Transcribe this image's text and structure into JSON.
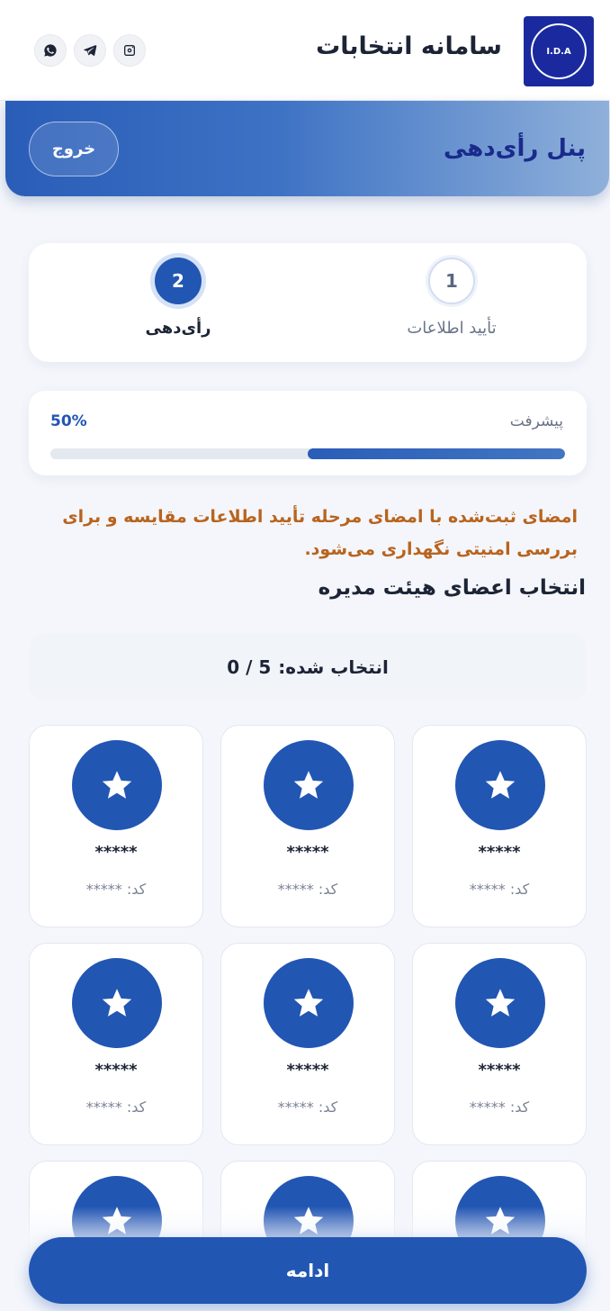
{
  "header": {
    "title": "سامانه انتخابات",
    "logo_text": "I.D.A",
    "social": [
      "instagram-icon",
      "telegram-icon",
      "whatsapp-icon"
    ]
  },
  "panel": {
    "title": "پنل رأی‌دهی",
    "logout_label": "خروج"
  },
  "steps": [
    {
      "number": "1",
      "label": "تأیید اطلاعات",
      "state": "inactive"
    },
    {
      "number": "2",
      "label": "رأی‌دهی",
      "state": "active"
    }
  ],
  "progress": {
    "label": "پیشرفت",
    "value_text": "50%",
    "value": 0.5
  },
  "notice": "امضای ثبت‌شده با امضای مرحله تأیید اطلاعات مقایسه و برای بررسی امنیتی نگهداری می‌شود.",
  "section_title": "انتخاب اعضای هیئت مدیره",
  "selection": {
    "label": "انتخاب شده:",
    "count": "0 / 5"
  },
  "candidates": [
    {
      "name": "*****",
      "code_label": "کد:",
      "code": "*****"
    },
    {
      "name": "*****",
      "code_label": "کد:",
      "code": "*****"
    },
    {
      "name": "*****",
      "code_label": "کد:",
      "code": "*****"
    },
    {
      "name": "*****",
      "code_label": "کد:",
      "code": "*****"
    },
    {
      "name": "*****",
      "code_label": "کد:",
      "code": "*****"
    },
    {
      "name": "*****",
      "code_label": "کد:",
      "code": "*****"
    },
    {
      "name": "",
      "code_label": "",
      "code": ""
    },
    {
      "name": "",
      "code_label": "",
      "code": ""
    },
    {
      "name": "",
      "code_label": "",
      "code": ""
    }
  ],
  "continue_label": "ادامه",
  "colors": {
    "primary": "#2256b3",
    "warning_text": "#b8641e",
    "panel_title": "#1a2a8c"
  }
}
